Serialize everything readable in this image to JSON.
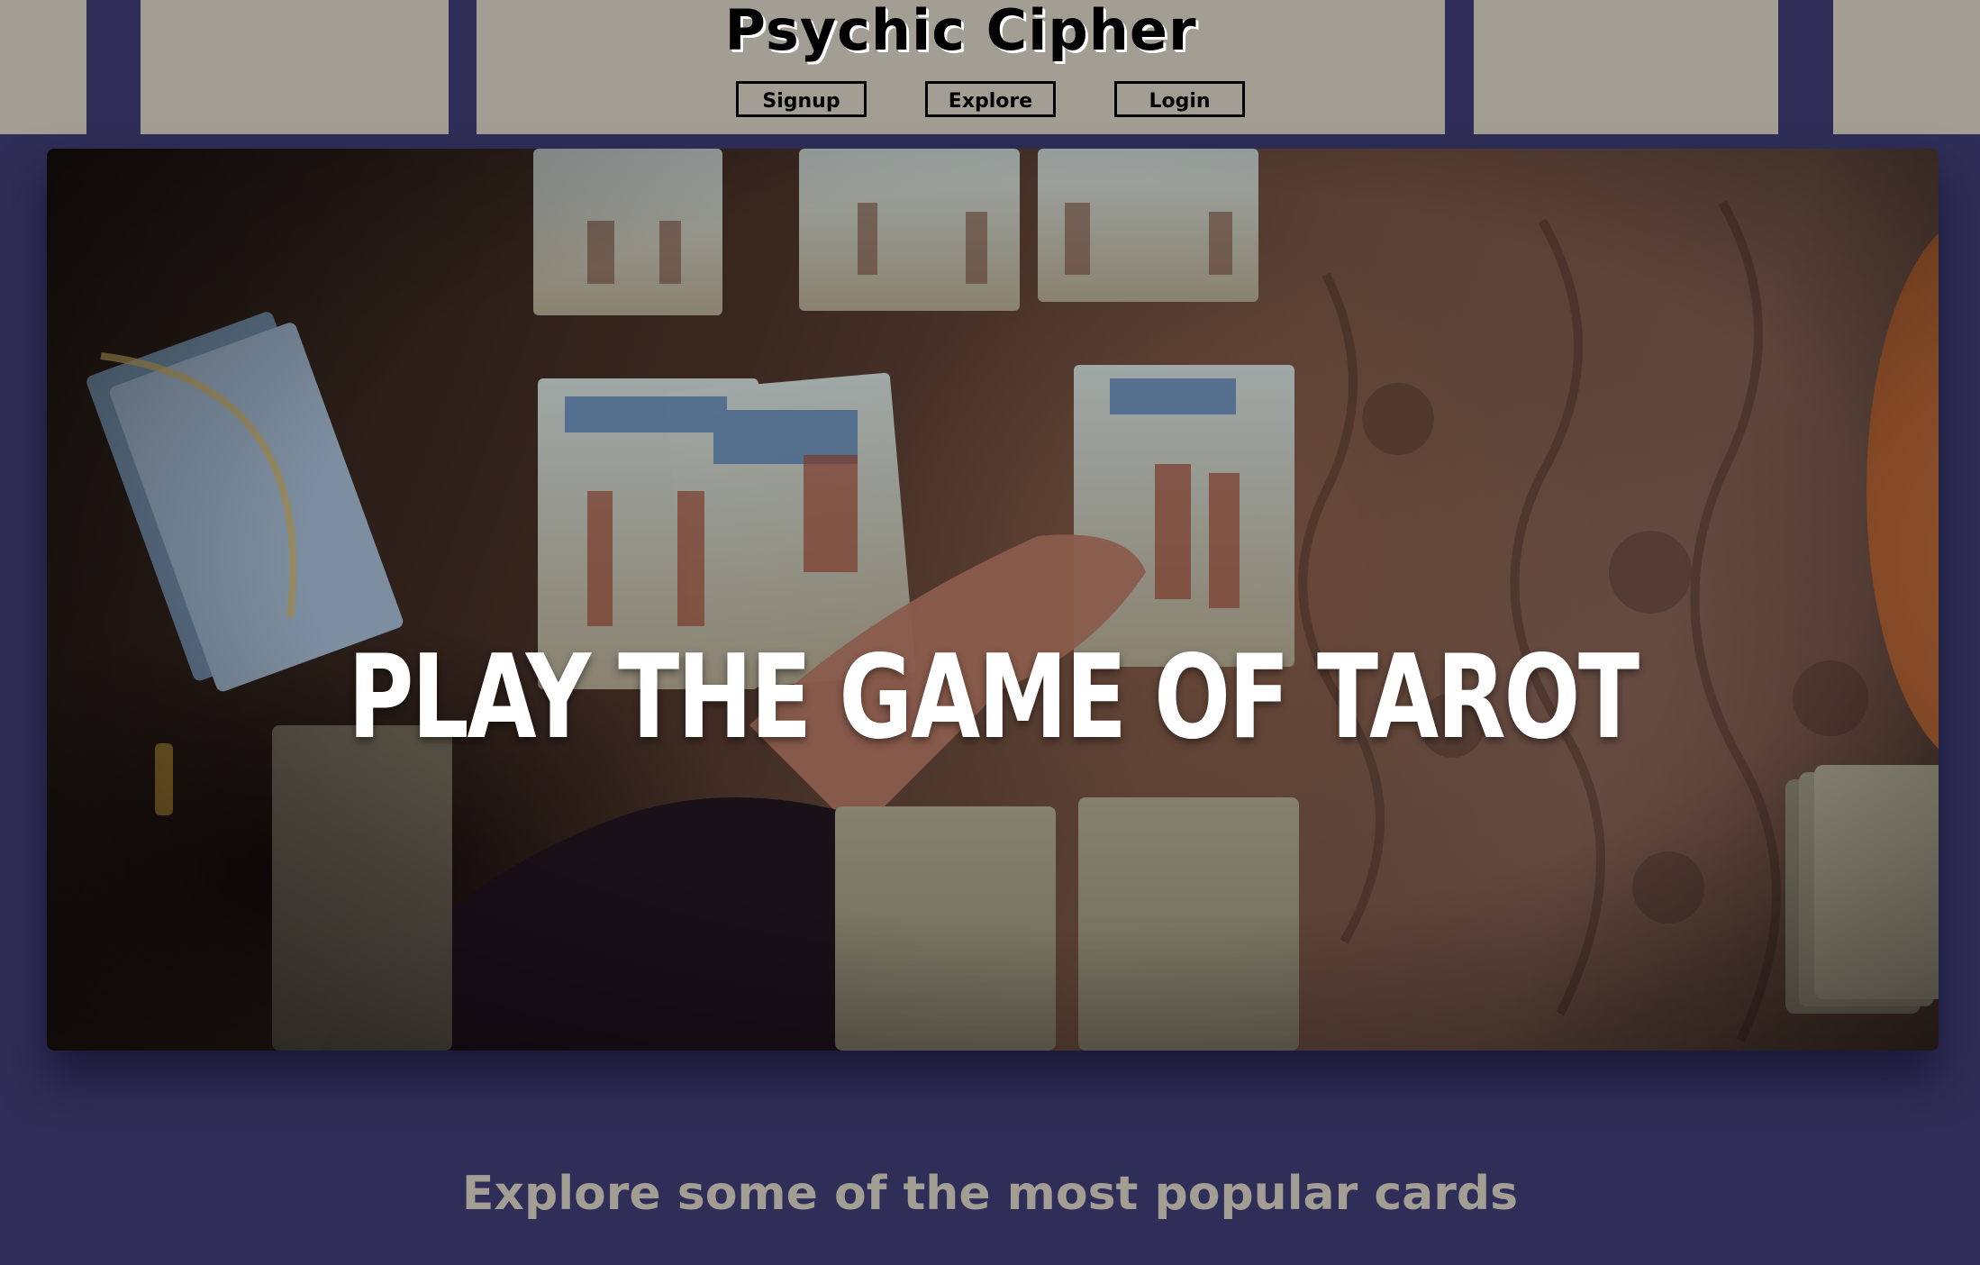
{
  "header": {
    "site_title": "Psychic Cipher",
    "nav": {
      "signup_label": "Signup",
      "explore_label": "Explore",
      "login_label": "Login"
    }
  },
  "hero": {
    "title": "PLAY THE GAME OF TAROT",
    "image_description_icon": "tarot-cards-table-photo"
  },
  "explore": {
    "heading": "Explore some of the most popular cards"
  },
  "colors": {
    "page_background": "#2e2e58",
    "header_panel": "#a39e94",
    "heading_text": "#a39e94",
    "hero_text": "#ffffff"
  }
}
